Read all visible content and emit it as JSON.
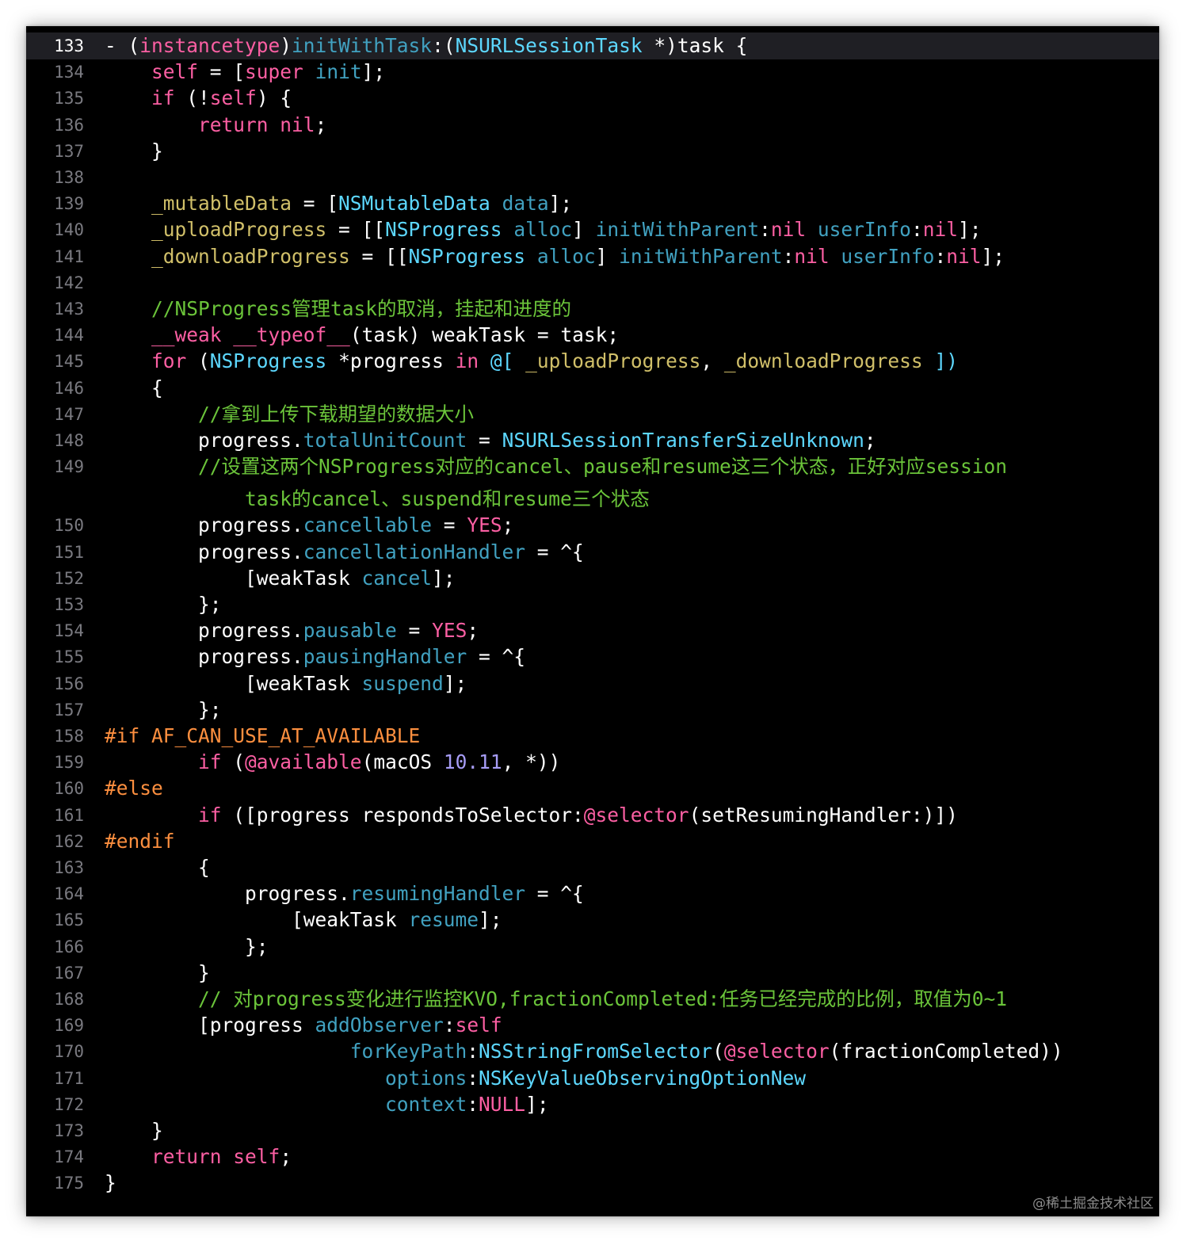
{
  "editor": {
    "theme_colors": {
      "background": "#000000",
      "current_line": "#1f1f24",
      "keyword": "#fc5fa3",
      "preprocessor": "#fd8f3f",
      "type": "#5dd8ff",
      "method": "#41a1c0",
      "comment": "#6bc43a",
      "number": "#a79df6",
      "line_number": "#7a7a80"
    },
    "current_line": 133,
    "lines": [
      {
        "n": "133",
        "indent": 0,
        "current": true,
        "tokens": [
          [
            "- (",
            ""
          ],
          [
            "instancetype",
            "kw"
          ],
          [
            ")",
            ""
          ],
          [
            "initWithTask",
            "pr"
          ],
          [
            ":(",
            ""
          ],
          [
            "NSURLSessionTask",
            "ty"
          ],
          [
            " *)task {",
            ""
          ]
        ]
      },
      {
        "n": "134",
        "indent": 1,
        "tokens": [
          [
            "self",
            "kw"
          ],
          [
            " = [",
            ""
          ],
          [
            "super",
            "kw"
          ],
          [
            " ",
            ""
          ],
          [
            "init",
            "pr"
          ],
          [
            "];",
            ""
          ]
        ]
      },
      {
        "n": "135",
        "indent": 1,
        "tokens": [
          [
            "if",
            "kw"
          ],
          [
            " (!",
            ""
          ],
          [
            "self",
            "kw"
          ],
          [
            ") {",
            ""
          ]
        ]
      },
      {
        "n": "136",
        "indent": 2,
        "tokens": [
          [
            "return",
            "kw"
          ],
          [
            " ",
            ""
          ],
          [
            "nil",
            "kw"
          ],
          [
            ";",
            ""
          ]
        ]
      },
      {
        "n": "137",
        "indent": 1,
        "tokens": [
          [
            "}",
            ""
          ]
        ]
      },
      {
        "n": "138",
        "indent": 0,
        "tokens": []
      },
      {
        "n": "139",
        "indent": 1,
        "tokens": [
          [
            "_mutableData",
            "nm"
          ],
          [
            " = [",
            ""
          ],
          [
            "NSMutableData",
            "ty"
          ],
          [
            " ",
            ""
          ],
          [
            "data",
            "pr"
          ],
          [
            "];",
            ""
          ]
        ]
      },
      {
        "n": "140",
        "indent": 1,
        "tokens": [
          [
            "_uploadProgress",
            "nm"
          ],
          [
            " = [[",
            ""
          ],
          [
            "NSProgress",
            "ty"
          ],
          [
            " ",
            ""
          ],
          [
            "alloc",
            "pr"
          ],
          [
            "] ",
            ""
          ],
          [
            "initWithParent",
            "pr"
          ],
          [
            ":",
            ""
          ],
          [
            "nil",
            "kw"
          ],
          [
            " ",
            ""
          ],
          [
            "userInfo",
            "pr"
          ],
          [
            ":",
            ""
          ],
          [
            "nil",
            "kw"
          ],
          [
            "];",
            ""
          ]
        ]
      },
      {
        "n": "141",
        "indent": 1,
        "tokens": [
          [
            "_downloadProgress",
            "nm"
          ],
          [
            " = [[",
            ""
          ],
          [
            "NSProgress",
            "ty"
          ],
          [
            " ",
            ""
          ],
          [
            "alloc",
            "pr"
          ],
          [
            "] ",
            ""
          ],
          [
            "initWithParent",
            "pr"
          ],
          [
            ":",
            ""
          ],
          [
            "nil",
            "kw"
          ],
          [
            " ",
            ""
          ],
          [
            "userInfo",
            "pr"
          ],
          [
            ":",
            ""
          ],
          [
            "nil",
            "kw"
          ],
          [
            "];",
            ""
          ]
        ]
      },
      {
        "n": "142",
        "indent": 0,
        "tokens": []
      },
      {
        "n": "143",
        "indent": 1,
        "tokens": [
          [
            "//NSProgress管理task的取消，挂起和进度的",
            "cm"
          ]
        ]
      },
      {
        "n": "144",
        "indent": 1,
        "tokens": [
          [
            "__weak",
            "kw"
          ],
          [
            " ",
            ""
          ],
          [
            "__typeof__",
            "kw"
          ],
          [
            "(task) weakTask = task;",
            ""
          ]
        ]
      },
      {
        "n": "145",
        "indent": 1,
        "tokens": [
          [
            "for",
            "kw"
          ],
          [
            " (",
            ""
          ],
          [
            "NSProgress",
            "ty"
          ],
          [
            " *progress ",
            ""
          ],
          [
            "in",
            "kw"
          ],
          [
            " ",
            ""
          ],
          [
            "@[",
            "ty"
          ],
          [
            " ",
            ""
          ],
          [
            "_uploadProgress",
            "nm"
          ],
          [
            ", ",
            ""
          ],
          [
            "_downloadProgress",
            "nm"
          ],
          [
            " ",
            ""
          ],
          [
            "])",
            "ty"
          ]
        ]
      },
      {
        "n": "146",
        "indent": 1,
        "tokens": [
          [
            "{",
            ""
          ]
        ]
      },
      {
        "n": "147",
        "indent": 2,
        "tokens": [
          [
            "//拿到上传下载期望的数据大小",
            "cm"
          ]
        ]
      },
      {
        "n": "148",
        "indent": 2,
        "tokens": [
          [
            "progress.",
            ""
          ],
          [
            "totalUnitCount",
            "pr"
          ],
          [
            " = ",
            ""
          ],
          [
            "NSURLSessionTransferSizeUnknown",
            "ty"
          ],
          [
            ";",
            ""
          ]
        ]
      },
      {
        "n": "149",
        "indent": 2,
        "tokens": [
          [
            "//设置这两个NSProgress对应的cancel、pause和resume这三个状态，正好对应session",
            "cm"
          ]
        ]
      },
      {
        "n": "",
        "indent": 3,
        "tokens": [
          [
            "task的cancel、suspend和resume三个状态",
            "cm"
          ]
        ]
      },
      {
        "n": "150",
        "indent": 2,
        "tokens": [
          [
            "progress.",
            ""
          ],
          [
            "cancellable",
            "pr"
          ],
          [
            " = ",
            ""
          ],
          [
            "YES",
            "kw"
          ],
          [
            ";",
            ""
          ]
        ]
      },
      {
        "n": "151",
        "indent": 2,
        "tokens": [
          [
            "progress.",
            ""
          ],
          [
            "cancellationHandler",
            "pr"
          ],
          [
            " = ^{",
            ""
          ]
        ]
      },
      {
        "n": "152",
        "indent": 3,
        "tokens": [
          [
            "[weakTask ",
            ""
          ],
          [
            "cancel",
            "pr"
          ],
          [
            "];",
            ""
          ]
        ]
      },
      {
        "n": "153",
        "indent": 2,
        "tokens": [
          [
            "};",
            ""
          ]
        ]
      },
      {
        "n": "154",
        "indent": 2,
        "tokens": [
          [
            "progress.",
            ""
          ],
          [
            "pausable",
            "pr"
          ],
          [
            " = ",
            ""
          ],
          [
            "YES",
            "kw"
          ],
          [
            ";",
            ""
          ]
        ]
      },
      {
        "n": "155",
        "indent": 2,
        "tokens": [
          [
            "progress.",
            ""
          ],
          [
            "pausingHandler",
            "pr"
          ],
          [
            " = ^{",
            ""
          ]
        ]
      },
      {
        "n": "156",
        "indent": 3,
        "tokens": [
          [
            "[weakTask ",
            ""
          ],
          [
            "suspend",
            "pr"
          ],
          [
            "];",
            ""
          ]
        ]
      },
      {
        "n": "157",
        "indent": 2,
        "tokens": [
          [
            "};",
            ""
          ]
        ]
      },
      {
        "n": "158",
        "indent": 0,
        "tokens": [
          [
            "#if AF_CAN_USE_AT_AVAILABLE",
            "pp"
          ]
        ]
      },
      {
        "n": "159",
        "indent": 2,
        "tokens": [
          [
            "if",
            "kw"
          ],
          [
            " (",
            ""
          ],
          [
            "@available",
            "kw"
          ],
          [
            "(macOS ",
            ""
          ],
          [
            "10.11",
            "num"
          ],
          [
            ", *))",
            ""
          ]
        ]
      },
      {
        "n": "160",
        "indent": 0,
        "tokens": [
          [
            "#else",
            "pp"
          ]
        ]
      },
      {
        "n": "161",
        "indent": 2,
        "tokens": [
          [
            "if",
            "kw"
          ],
          [
            " ([progress respondsToSelector:",
            ""
          ],
          [
            "@selector",
            "kw"
          ],
          [
            "(setResumingHandler:)])",
            ""
          ]
        ]
      },
      {
        "n": "162",
        "indent": 0,
        "tokens": [
          [
            "#endif",
            "pp"
          ]
        ]
      },
      {
        "n": "163",
        "indent": 2,
        "tokens": [
          [
            "{",
            ""
          ]
        ]
      },
      {
        "n": "164",
        "indent": 3,
        "tokens": [
          [
            "progress.",
            ""
          ],
          [
            "resumingHandler",
            "pr"
          ],
          [
            " = ^{",
            ""
          ]
        ]
      },
      {
        "n": "165",
        "indent": 4,
        "tokens": [
          [
            "[weakTask ",
            ""
          ],
          [
            "resume",
            "pr"
          ],
          [
            "];",
            ""
          ]
        ]
      },
      {
        "n": "166",
        "indent": 3,
        "tokens": [
          [
            "};",
            ""
          ]
        ]
      },
      {
        "n": "167",
        "indent": 2,
        "tokens": [
          [
            "}",
            ""
          ]
        ]
      },
      {
        "n": "168",
        "indent": 2,
        "tokens": [
          [
            "// 对progress变化进行监控KVO,fractionCompleted:任务已经完成的比例，取值为0~1",
            "cm"
          ]
        ]
      },
      {
        "n": "169",
        "indent": 2,
        "tokens": [
          [
            "[progress ",
            ""
          ],
          [
            "addObserver",
            "pr"
          ],
          [
            ":",
            ""
          ],
          [
            "self",
            "kw"
          ]
        ]
      },
      {
        "n": "170",
        "indent": 0,
        "pad": "                     ",
        "tokens": [
          [
            "forKeyPath",
            "pr"
          ],
          [
            ":",
            ""
          ],
          [
            "NSStringFromSelector",
            "ty"
          ],
          [
            "(",
            ""
          ],
          [
            "@selector",
            "kw"
          ],
          [
            "(fractionCompleted))",
            ""
          ]
        ]
      },
      {
        "n": "171",
        "indent": 0,
        "pad": "                        ",
        "tokens": [
          [
            "options",
            "pr"
          ],
          [
            ":",
            ""
          ],
          [
            "NSKeyValueObservingOptionNew",
            "ty"
          ]
        ]
      },
      {
        "n": "172",
        "indent": 0,
        "pad": "                        ",
        "tokens": [
          [
            "context",
            "pr"
          ],
          [
            ":",
            ""
          ],
          [
            "NULL",
            "kw"
          ],
          [
            "];",
            ""
          ]
        ]
      },
      {
        "n": "173",
        "indent": 1,
        "tokens": [
          [
            "}",
            ""
          ]
        ]
      },
      {
        "n": "174",
        "indent": 1,
        "tokens": [
          [
            "return",
            "kw"
          ],
          [
            " ",
            ""
          ],
          [
            "self",
            "kw"
          ],
          [
            ";",
            ""
          ]
        ]
      },
      {
        "n": "175",
        "indent": 0,
        "tokens": [
          [
            "}",
            ""
          ]
        ]
      }
    ]
  },
  "watermark": "@稀土掘金技术社区"
}
